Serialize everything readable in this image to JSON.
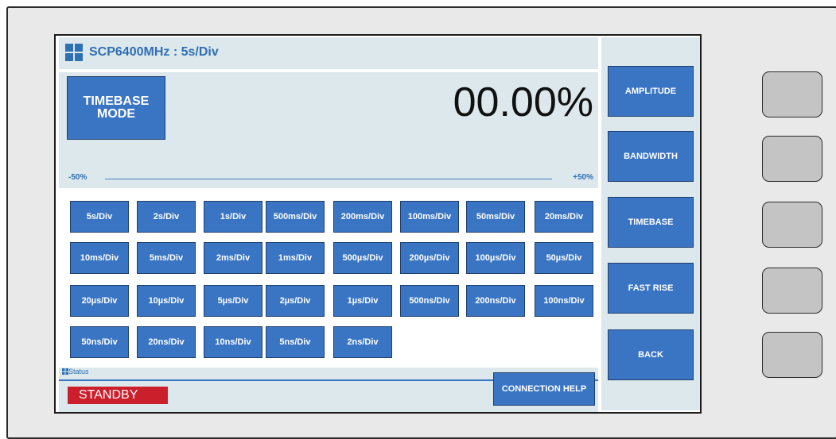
{
  "header": {
    "title": "SCP6400MHz : 5s/Div"
  },
  "display": {
    "mode_button": "TIMEBASE\nMODE",
    "readout": "00.00%",
    "scale_min": "-50%",
    "scale_max": "+50%"
  },
  "timebase_buttons": [
    "5s/Div",
    "2s/Div",
    "1s/Div",
    "500ms/Div",
    "200ms/Div",
    "100ms/Div",
    "50ms/Div",
    "20ms/Div",
    "10ms/Div",
    "5ms/Div",
    "2ms/Div",
    "1ms/Div",
    "500µs/Div",
    "200µs/Div",
    "100µs/Div",
    "50µs/Div",
    "20µs/Div",
    "10µs/Div",
    "5µs/Div",
    "2µs/Div",
    "1µs/Div",
    "500ns/Div",
    "200ns/Div",
    "100ns/Div",
    "50ns/Div",
    "20ns/Div",
    "10ns/Div",
    "5ns/Div",
    "2ns/Div"
  ],
  "status": {
    "label": "Status",
    "value": "STANDBY",
    "connection_help": "CONNECTION HELP"
  },
  "side_menu": [
    "AMPLITUDE",
    "BANDWIDTH",
    "TIMEBASE",
    "FAST RISE",
    "BACK"
  ],
  "colors": {
    "accent": "#3a75c4",
    "panel": "#dce8ec",
    "standby": "#cc1f2c"
  }
}
